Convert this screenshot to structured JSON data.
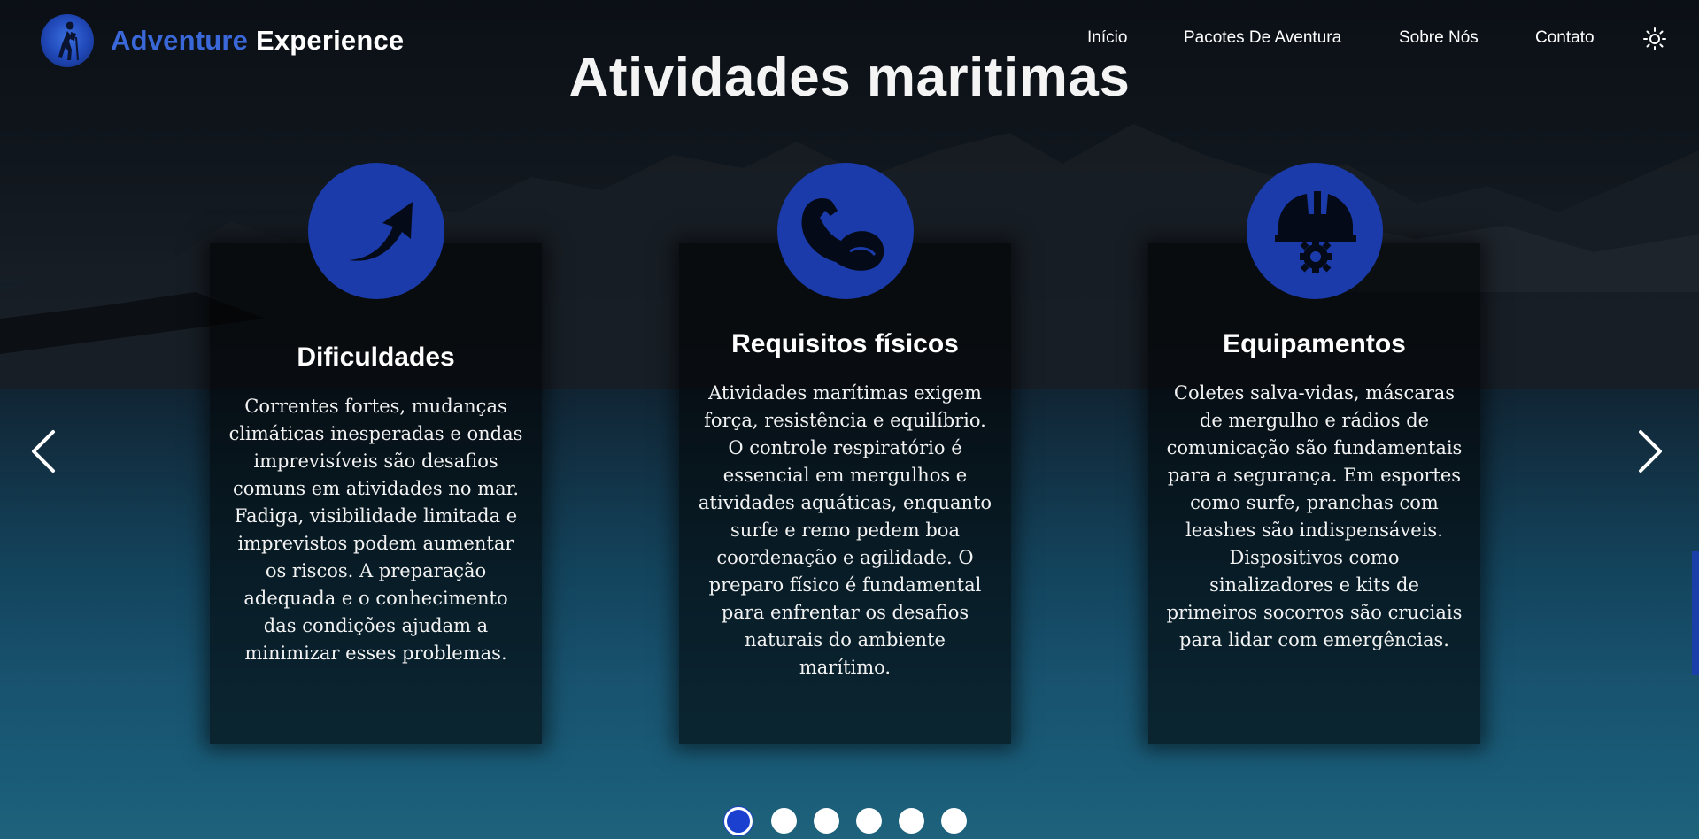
{
  "brand": {
    "part1": "Adventure",
    "part2": "Experience",
    "logo_icon": "hiker-icon"
  },
  "nav": {
    "items": [
      "Início",
      "Pacotes De Aventura",
      "Sobre Nós",
      "Contato"
    ],
    "theme_icon": "sun-icon"
  },
  "page": {
    "title": "Atividades maritimas"
  },
  "cards": [
    {
      "icon": "trending-up-arrow-icon",
      "title": "Dificuldades",
      "text": "Correntes fortes, mudanças climáticas inesperadas e ondas imprevisíveis são desafios comuns em atividades no mar. Fadiga, visibilidade limitada e imprevistos podem aumentar os riscos. A preparação adequada e o conhecimento das condições ajudam a minimizar esses problemas."
    },
    {
      "icon": "flexed-bicep-icon",
      "title": "Requisitos físicos",
      "text": "Atividades marítimas exigem força, resistência e equilíbrio. O controle respiratório é essencial em mergulhos e atividades aquáticas, enquanto surfe e remo pedem boa coordenação e agilidade. O preparo físico é fundamental para enfrentar os desafios naturais do ambiente marítimo."
    },
    {
      "icon": "safety-helmet-gear-icon",
      "title": "Equipamentos",
      "text": "Coletes salva-vidas, máscaras de mergulho e rádios de comunicação são fundamentais para a segurança. Em esportes como surfe, pranchas com leashes são indispensáveis. Dispositivos como sinalizadores e kits de primeiros socorros são cruciais para lidar com emergências."
    }
  ],
  "carousel": {
    "slide_count": 6,
    "active_index": 0,
    "prev_icon": "chevron-left-icon",
    "next_icon": "chevron-right-icon"
  },
  "colors": {
    "accent": "#1b3bab",
    "brand_blue": "#3a68d8"
  }
}
